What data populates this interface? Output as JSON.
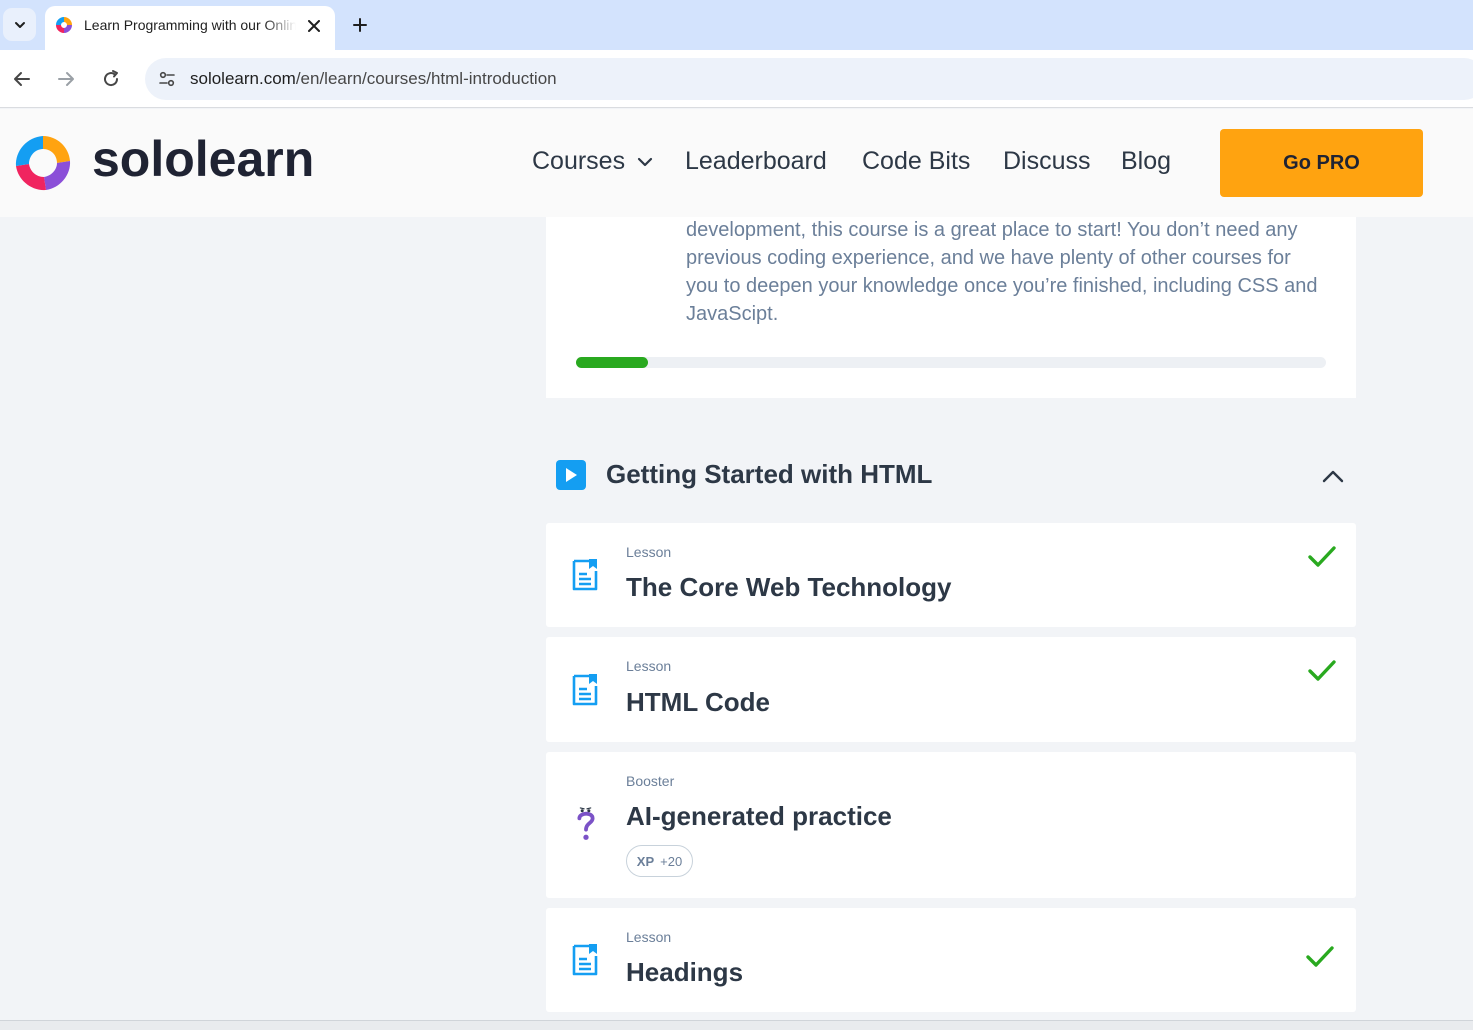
{
  "browser": {
    "tab_title": "Learn Programming with our Online Courses",
    "url_host": "sololearn.com",
    "url_path": "/en/learn/courses/html-introduction"
  },
  "header": {
    "logo_text": "sololearn",
    "nav": {
      "courses": "Courses",
      "leaderboard": "Leaderboard",
      "code_bits": "Code Bits",
      "discuss": "Discuss",
      "blog": "Blog"
    },
    "go_pro": "Go PRO"
  },
  "course": {
    "description_lines": [
      "development, this course is a great place to start! You don’t need any",
      "previous coding experience, and we have plenty of other courses for",
      "you to deepen your knowledge once you’re finished, including CSS and",
      "JavaScipt."
    ],
    "progress_fraction": 0.096
  },
  "module": {
    "title": "Getting Started with HTML",
    "expanded": true,
    "items": [
      {
        "kind": "Lesson",
        "title": "The Core Web Technology",
        "completed": true,
        "icon": "lesson-icon"
      },
      {
        "kind": "Lesson",
        "title": "HTML Code",
        "completed": true,
        "icon": "lesson-icon"
      },
      {
        "kind": "Booster",
        "title": "AI-generated practice",
        "completed": false,
        "icon": "question-icon",
        "xp_label": "XP",
        "xp_value": "+20"
      },
      {
        "kind": "Lesson",
        "title": "Headings",
        "completed": true,
        "icon": "lesson-icon"
      }
    ]
  },
  "colors": {
    "accent_blue": "#149ef2",
    "pro_orange": "#ffa310",
    "progress_green": "#29a91f",
    "check_green": "#29a91f",
    "booster_purple": "#7b52c7"
  }
}
